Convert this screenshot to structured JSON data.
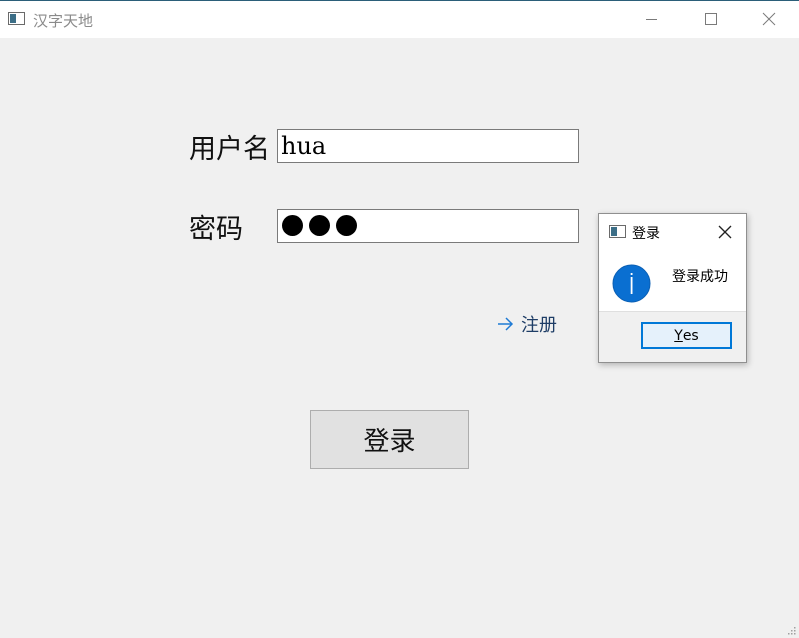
{
  "window": {
    "title": "汉字天地",
    "icon": "app-window-icon",
    "controls": {
      "minimize_icon": "minimize-icon",
      "maximize_icon": "maximize-icon",
      "close_icon": "close-icon"
    }
  },
  "form": {
    "username_label": "用户名",
    "username_value": "hua",
    "password_label": "密码",
    "password_masked_count": 3,
    "register_icon": "arrow-right-icon",
    "register_label": "注册",
    "login_label": "登录"
  },
  "dialog": {
    "title": "登录",
    "icon": "app-window-icon",
    "close_icon": "close-icon",
    "info_icon": "information-icon",
    "message": "登录成功",
    "yes_label_accel": "Y",
    "yes_label_rest": "es"
  },
  "colors": {
    "accent": "#0078d7",
    "info_icon": "#0a6fd1",
    "link_arrow": "#1e7ad4"
  }
}
